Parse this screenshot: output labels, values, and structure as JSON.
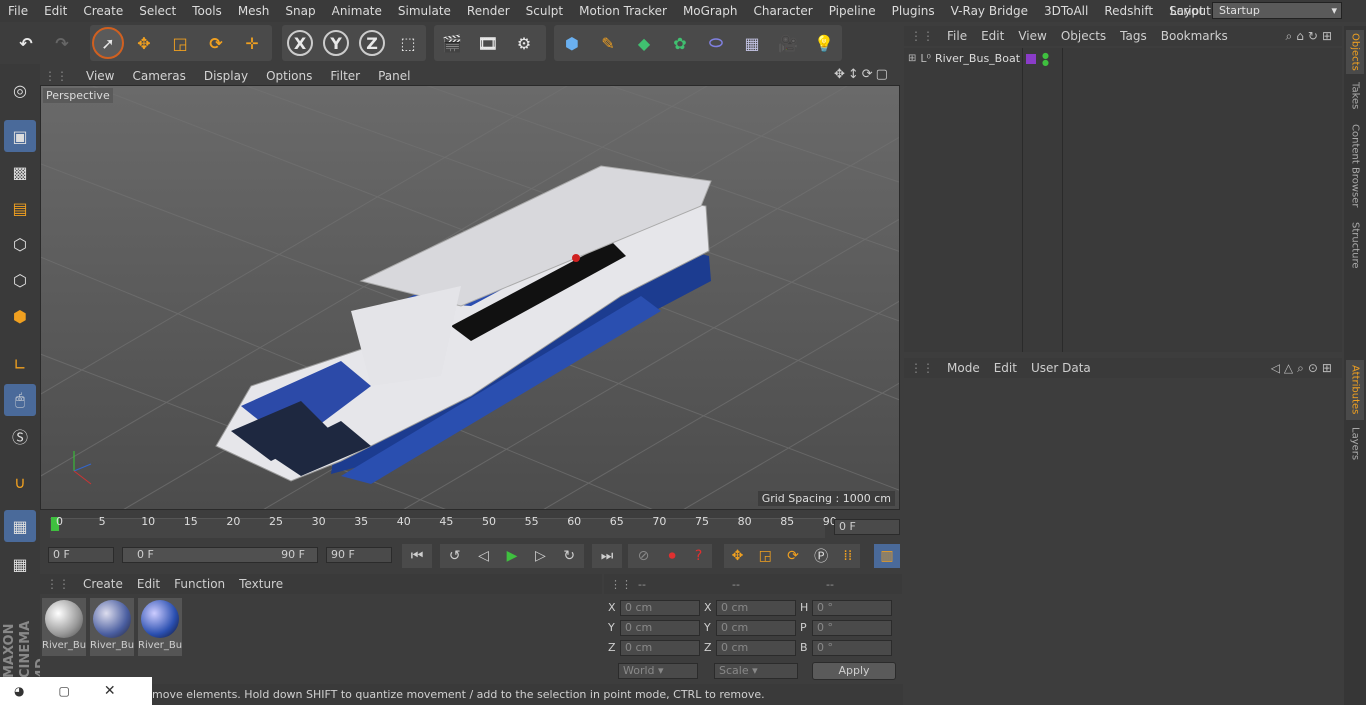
{
  "menu": [
    "File",
    "Edit",
    "Create",
    "Select",
    "Tools",
    "Mesh",
    "Snap",
    "Animate",
    "Simulate",
    "Render",
    "Sculpt",
    "Motion Tracker",
    "MoGraph",
    "Character",
    "Pipeline",
    "Plugins",
    "V-Ray Bridge",
    "3DToAll",
    "Redshift",
    "Script",
    "Window",
    "Help"
  ],
  "layout": {
    "label": "Layout:",
    "value": "Startup"
  },
  "toolbar": {
    "x": "X",
    "y": "Y",
    "z": "Z"
  },
  "viewport": {
    "menu": [
      "View",
      "Cameras",
      "Display",
      "Options",
      "Filter",
      "Panel"
    ],
    "label": "Perspective",
    "grid": "Grid Spacing : 1000 cm"
  },
  "timeline": {
    "ticks": [
      "0",
      "5",
      "10",
      "15",
      "20",
      "25",
      "30",
      "35",
      "40",
      "45",
      "50",
      "55",
      "60",
      "65",
      "70",
      "75",
      "80",
      "85",
      "90"
    ],
    "current": "0 F",
    "start": "0 F",
    "range_start": "0 F",
    "range_end": "90 F",
    "end": "90 F"
  },
  "materials": {
    "menu": [
      "Create",
      "Edit",
      "Function",
      "Texture"
    ],
    "items": [
      "River_Bu",
      "River_Bu",
      "River_Bu"
    ]
  },
  "coords": {
    "headers": [
      "--",
      "--",
      "--"
    ],
    "rows": [
      {
        "a": "X",
        "av": "0 cm",
        "b": "X",
        "bv": "0 cm",
        "c": "H",
        "cv": "0 °"
      },
      {
        "a": "Y",
        "av": "0 cm",
        "b": "Y",
        "bv": "0 cm",
        "c": "P",
        "cv": "0 °"
      },
      {
        "a": "Z",
        "av": "0 cm",
        "b": "Z",
        "bv": "0 cm",
        "c": "B",
        "cv": "0 °"
      }
    ],
    "space": "World",
    "mode": "Scale",
    "apply": "Apply"
  },
  "status": "move elements. Hold down SHIFT to quantize movement / add to the selection in point mode, CTRL to remove.",
  "objects": {
    "menu": [
      "File",
      "Edit",
      "View",
      "Objects",
      "Tags",
      "Bookmarks"
    ],
    "item": "River_Bus_Boat"
  },
  "attributes": {
    "menu": [
      "Mode",
      "Edit",
      "User Data"
    ]
  },
  "sidetabs": [
    "Objects",
    "Takes",
    "Content Browser",
    "Structure",
    "Attributes",
    "Layers"
  ],
  "brand": {
    "maxon": "MAXON",
    "cinema": "CINEMA 4D"
  },
  "colors": {
    "accent": "#f0a020",
    "blue": "#2a4fb0",
    "bg": "#3d3d3d"
  }
}
